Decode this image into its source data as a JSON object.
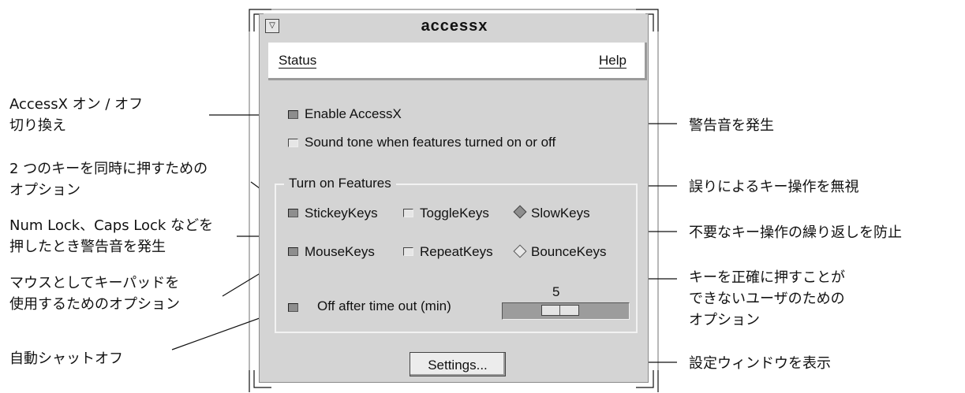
{
  "window": {
    "title": "accessx",
    "menu_button_glyph": "▽",
    "menu": {
      "status": "Status",
      "help": "Help"
    }
  },
  "controls": {
    "enable_accessx": {
      "label": "Enable AccessX",
      "checked": true
    },
    "sound_tone": {
      "label": "Sound tone when features turned on or off",
      "checked": false
    },
    "group_title": "Turn on Features",
    "stickykeys": {
      "label": "StickeyKeys",
      "checked": true
    },
    "togglekeys": {
      "label": "ToggleKeys",
      "checked": false
    },
    "slowkeys": {
      "label": "SlowKeys",
      "checked": true
    },
    "mousekeys": {
      "label": "MouseKeys",
      "checked": true
    },
    "repeatkeys": {
      "label": "RepeatKeys",
      "checked": false
    },
    "bouncekeys": {
      "label": "BounceKeys",
      "checked": false
    },
    "timeout": {
      "label": "Off after time out (min)",
      "checked": true,
      "value": "5"
    },
    "settings_button": "Settings..."
  },
  "annotations": {
    "enable_toggle": [
      "AccessX オン / オフ",
      "切り換え"
    ],
    "two_keys": [
      "2 つのキーを同時に押すための",
      "オプション"
    ],
    "lock_keys": [
      "Num Lock、Caps Lock などを",
      "押したとき警告音を発生"
    ],
    "mouse_keys": [
      "マウスとしてキーパッドを",
      "使用するためのオプション"
    ],
    "auto_shutoff": [
      "自動シャットオフ"
    ],
    "warning_tone": [
      "警告音を発生"
    ],
    "ignore_errors": [
      "誤りによるキー操作を無視"
    ],
    "prevent_repeat": [
      "不要なキー操作の繰り返しを防止"
    ],
    "bounce": [
      "キーを正確に押すことが",
      "できないユーザのための",
      "オプション"
    ],
    "settings_window": [
      "設定ウィンドウを表示"
    ]
  }
}
